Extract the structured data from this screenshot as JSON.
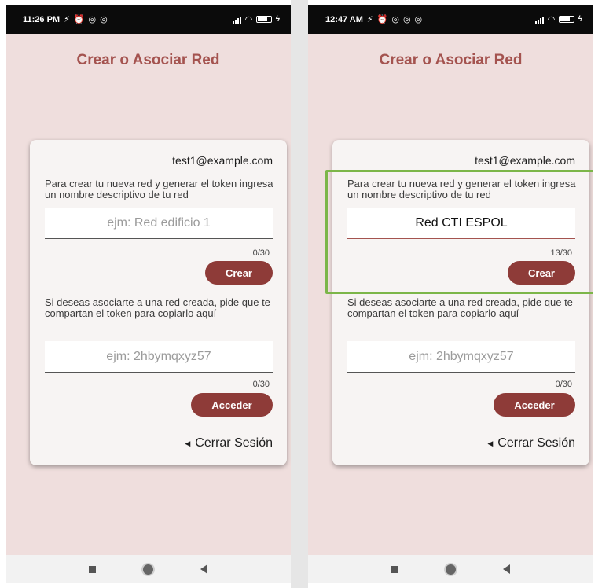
{
  "screens": [
    {
      "time": "11:26 PM",
      "title": "Crear o Asociar Red",
      "email": "test1@example.com",
      "create_prompt": "Para crear tu nueva red y generar el token ingresa un nombre descriptivo de tu red",
      "network_name": {
        "value": "",
        "placeholder": "ejm: Red edificio 1",
        "counter": "0/30"
      },
      "create_button": "Crear",
      "join_prompt": "Si deseas asociarte a una red creada, pide que te compartan el token para copiarlo aquí",
      "token": {
        "value": "",
        "placeholder": "ejm: 2hbymqxyz57",
        "counter": "0/30"
      },
      "join_button": "Acceder",
      "logout": "Cerrar Sesión"
    },
    {
      "time": "12:47 AM",
      "title": "Crear o Asociar Red",
      "email": "test1@example.com",
      "create_prompt": "Para crear tu nueva red y generar el token ingresa un nombre descriptivo de tu red",
      "network_name": {
        "value": "Red CTI ESPOL",
        "placeholder": "ejm: Red edificio 1",
        "counter": "13/30"
      },
      "create_button": "Crear",
      "join_prompt": "Si deseas asociarte a una red creada, pide que te compartan el token para copiarlo aquí",
      "token": {
        "value": "",
        "placeholder": "ejm: 2hbymqxyz57",
        "counter": "0/30"
      },
      "join_button": "Acceder",
      "logout": "Cerrar Sesión"
    }
  ],
  "colors": {
    "background": "#efdedd",
    "accent": "#a4534f",
    "button": "#8e3b38",
    "highlight": "#7cb649"
  }
}
